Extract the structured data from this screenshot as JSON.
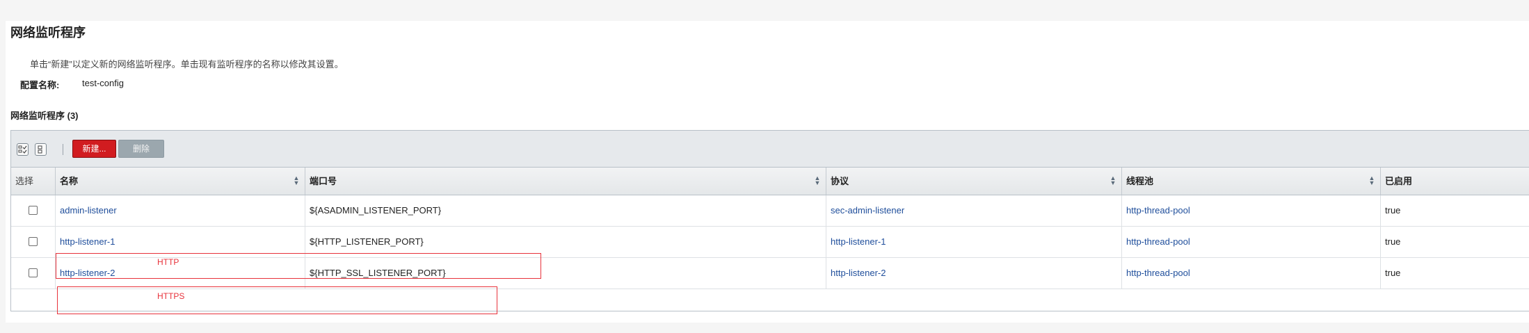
{
  "page": {
    "title": "网络监听程序",
    "help_text": "单击“新建”以定义新的网络监听程序。单击现有监听程序的名称以修改其设置。",
    "config_label": "配置名称:",
    "config_value": "test-config"
  },
  "table": {
    "title": "网络监听程序 (3)",
    "toolbar": {
      "select_all_icon": "select-all-icon",
      "deselect_all_icon": "deselect-all-icon",
      "new_label": "新建...",
      "delete_label": "删除"
    },
    "headers": {
      "select": "选择",
      "name": "名称",
      "port": "端口号",
      "protocol": "协议",
      "thread_pool": "线程池",
      "enabled": "已启用"
    },
    "rows": [
      {
        "name": "admin-listener",
        "port": "${ASADMIN_LISTENER_PORT}",
        "protocol": "sec-admin-listener",
        "thread_pool": "http-thread-pool",
        "enabled": "true"
      },
      {
        "name": "http-listener-1",
        "port": "${HTTP_LISTENER_PORT}",
        "protocol": "http-listener-1",
        "thread_pool": "http-thread-pool",
        "enabled": "true"
      },
      {
        "name": "http-listener-2",
        "port": "${HTTP_SSL_LISTENER_PORT}",
        "protocol": "http-listener-2",
        "thread_pool": "http-thread-pool",
        "enabled": "true"
      }
    ]
  },
  "annotations": {
    "http_label": "HTTP",
    "https_label": "HTTPS",
    "color": "#e8323b"
  },
  "colors": {
    "new_button": "#d11c20",
    "delete_button": "#9ba7ae",
    "link": "#1f4e9b",
    "toolbar_bg": "#e6e9ec"
  }
}
